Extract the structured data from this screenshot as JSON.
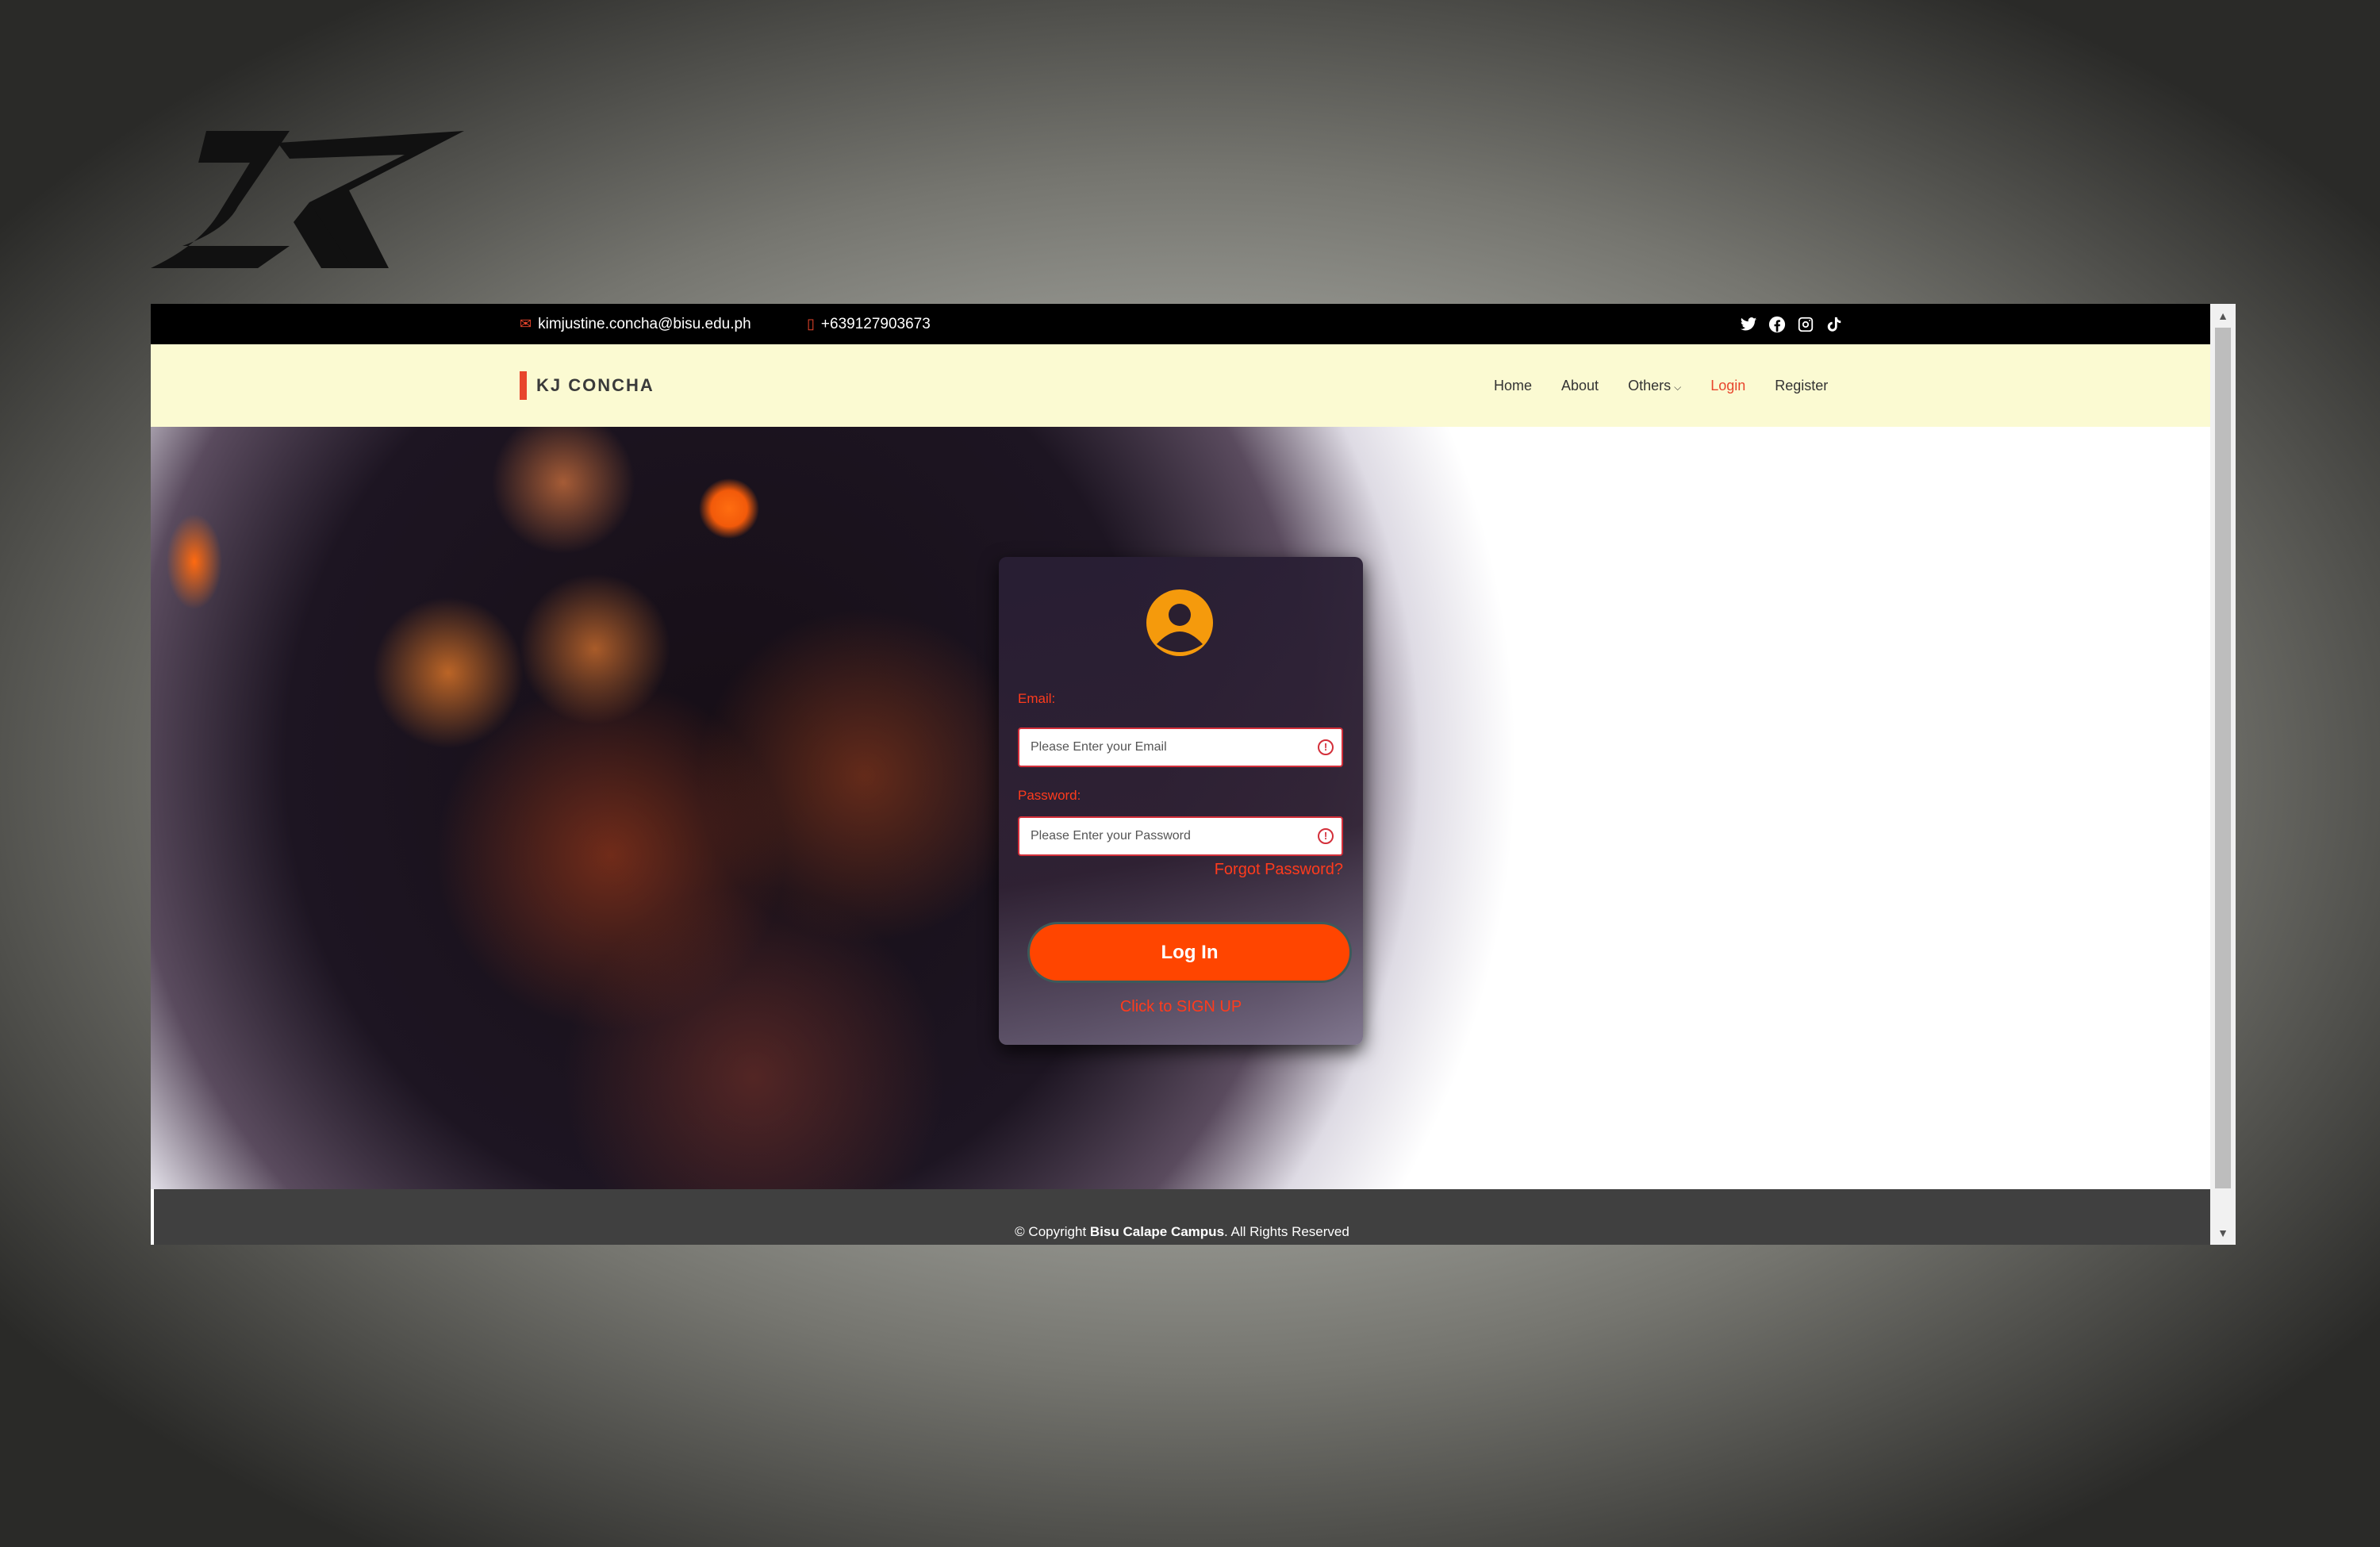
{
  "topbar": {
    "email": "kimjustine.concha@bisu.edu.ph",
    "phone": "+639127903673",
    "socials": [
      "twitter-icon",
      "facebook-icon",
      "instagram-icon",
      "tiktok-icon"
    ]
  },
  "navbar": {
    "brand": "KJ CONCHA",
    "links": {
      "home": "Home",
      "about": "About",
      "others": "Others",
      "login": "Login",
      "register": "Register"
    }
  },
  "login": {
    "email_label": "Email:",
    "email_placeholder": "Please Enter your Email",
    "password_label": "Password:",
    "password_placeholder": "Please Enter your Password",
    "forgot": "Forgot Password?",
    "button": "Log In",
    "signup": "Click to SIGN UP"
  },
  "footer": {
    "prefix": "© Copyright",
    "org": "Bisu Calape Campus",
    "suffix": ". All Rights Reserved"
  },
  "colors": {
    "accent": "#ff4500",
    "error": "#d32f3a",
    "navbar_bg": "#fbfad2",
    "avatar": "#f59a0c"
  }
}
